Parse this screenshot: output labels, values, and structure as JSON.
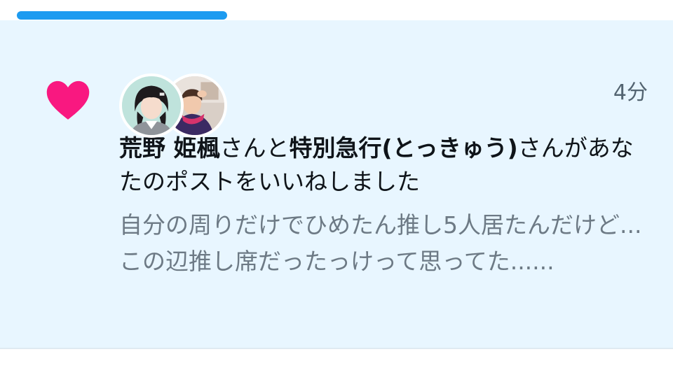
{
  "progress": {
    "value": 0.33,
    "color": "#1d9bf0"
  },
  "notification": {
    "type_icon": "heart-icon",
    "heart_color": "#f91880",
    "avatars": [
      {
        "name": "avatar-hime"
      },
      {
        "name": "avatar-tokkyu"
      }
    ],
    "timestamp": "4分",
    "actor1": "荒野 姫楓",
    "connector": "さんと",
    "actor2": "特別急行(とっきゅう)",
    "action": "さんがあなたのポストをいいねしました",
    "preview_text": "自分の周りだけでひめたん推し5人居たんだけど...\nこの辺推し席だったっけって思ってた......"
  }
}
